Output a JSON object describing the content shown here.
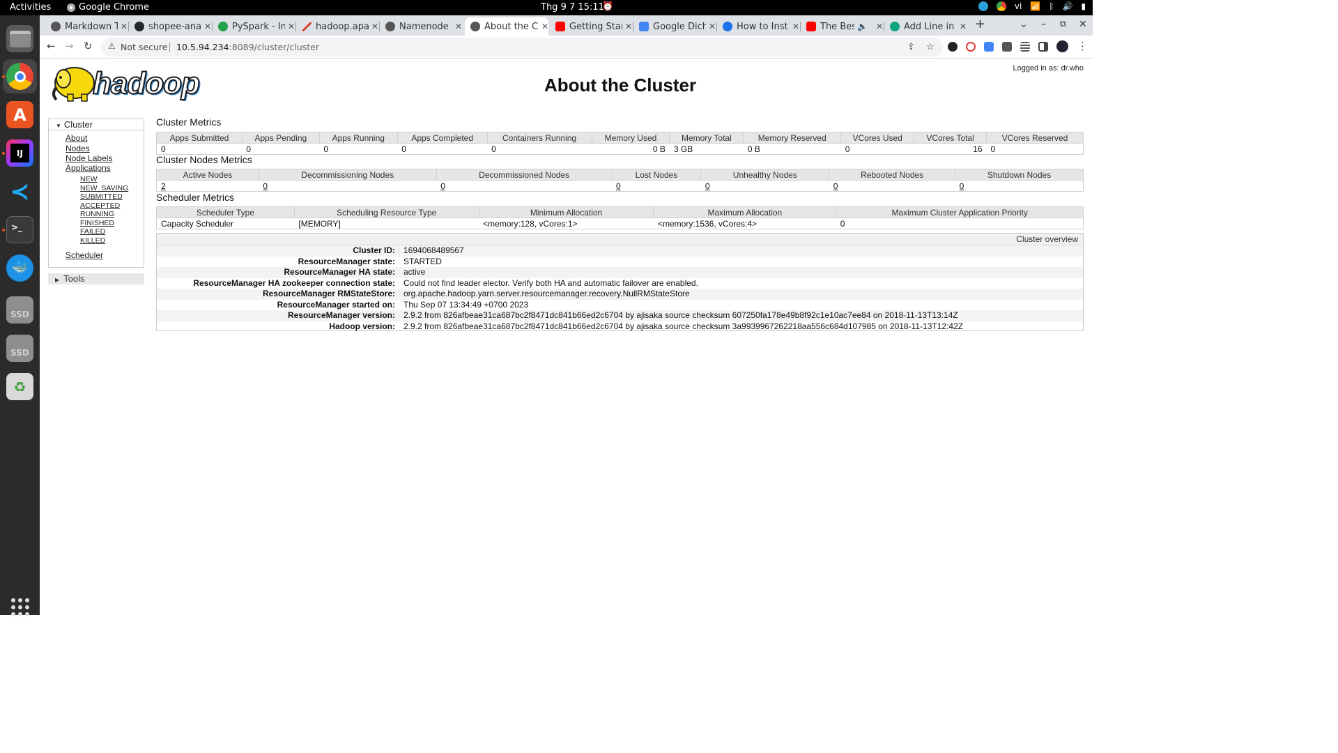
{
  "topbar": {
    "activities": "Activities",
    "app_name": "Google Chrome",
    "clock": "Thg 9 7  15:11",
    "lang": "vi"
  },
  "tabs": [
    {
      "title": "Markdown T",
      "favicon_color": "#555555"
    },
    {
      "title": "shopee-ana",
      "favicon_color": "#24292f"
    },
    {
      "title": "PySpark - Int",
      "favicon_color": "#22a34a"
    },
    {
      "title": "hadoop.apa",
      "favicon_color": "#d83b2a"
    },
    {
      "title": "Namenode",
      "favicon_color": "#555555"
    },
    {
      "title": "About the C",
      "favicon_color": "#555555",
      "active": true
    },
    {
      "title": "Getting Star",
      "favicon_color": "#ff0000"
    },
    {
      "title": "Google Dich",
      "favicon_color": "#4285f4"
    },
    {
      "title": "How to Inst",
      "favicon_color": "#1a73e8"
    },
    {
      "title": "The Best",
      "favicon_color": "#ff0000"
    },
    {
      "title": "Add Line in",
      "favicon_color": "#10a37f"
    }
  ],
  "addressbar": {
    "security": "Not secure",
    "url_host": "10.5.94.234",
    "url_rest": ":8089/cluster/cluster"
  },
  "page": {
    "logo_text": "hadoop",
    "title": "About the Cluster",
    "logged_in": "Logged in as: dr.who"
  },
  "nav": {
    "cluster_label": "Cluster",
    "links": [
      "About",
      "Nodes",
      "Node Labels",
      "Applications"
    ],
    "app_states": [
      "NEW",
      "NEW_SAVING",
      "SUBMITTED",
      "ACCEPTED",
      "RUNNING",
      "FINISHED",
      "FAILED",
      "KILLED"
    ],
    "scheduler": "Scheduler",
    "tools_label": "Tools"
  },
  "cluster_metrics": {
    "title": "Cluster Metrics",
    "headers": [
      "Apps Submitted",
      "Apps Pending",
      "Apps Running",
      "Apps Completed",
      "Containers Running",
      "Memory Used",
      "Memory Total",
      "Memory Reserved",
      "VCores Used",
      "VCores Total",
      "VCores Reserved"
    ],
    "values": [
      "0",
      "0",
      "0",
      "0",
      "0",
      "0 B",
      "3 GB",
      "0 B",
      "0",
      "16",
      "0"
    ]
  },
  "nodes_metrics": {
    "title": "Cluster Nodes Metrics",
    "headers": [
      "Active Nodes",
      "Decommissioning Nodes",
      "Decommissioned Nodes",
      "Lost Nodes",
      "Unhealthy Nodes",
      "Rebooted Nodes",
      "Shutdown Nodes"
    ],
    "values": [
      "2",
      "0",
      "0",
      "0",
      "0",
      "0",
      "0"
    ]
  },
  "scheduler_metrics": {
    "title": "Scheduler Metrics",
    "headers": [
      "Scheduler Type",
      "Scheduling Resource Type",
      "Minimum Allocation",
      "Maximum Allocation",
      "Maximum Cluster Application Priority"
    ],
    "values": [
      "Capacity Scheduler",
      "[MEMORY]",
      "<memory:128, vCores:1>",
      "<memory:1536, vCores:4>",
      "0"
    ]
  },
  "overview": {
    "header": "Cluster overview",
    "rows": [
      {
        "key": "Cluster ID:",
        "value": "1694068489567"
      },
      {
        "key": "ResourceManager state:",
        "value": "STARTED"
      },
      {
        "key": "ResourceManager HA state:",
        "value": "active"
      },
      {
        "key": "ResourceManager HA zookeeper connection state:",
        "value": "Could not find leader elector. Verify both HA and automatic failover are enabled."
      },
      {
        "key": "ResourceManager RMStateStore:",
        "value": "org.apache.hadoop.yarn.server.resourcemanager.recovery.NullRMStateStore"
      },
      {
        "key": "ResourceManager started on:",
        "value": "Thu Sep 07 13:34:49 +0700 2023"
      },
      {
        "key": "ResourceManager version:",
        "value": "2.9.2 from 826afbeae31ca687bc2f8471dc841b66ed2c6704 by ajisaka source checksum 607250fa178e49b8f92c1e10ac7ee84 on 2018-11-13T13:14Z"
      },
      {
        "key": "Hadoop version:",
        "value": "2.9.2 from 826afbeae31ca687bc2f8471dc841b66ed2c6704 by ajisaka source checksum 3a9939967262218aa556c684d107985 on 2018-11-13T12:42Z"
      }
    ]
  }
}
